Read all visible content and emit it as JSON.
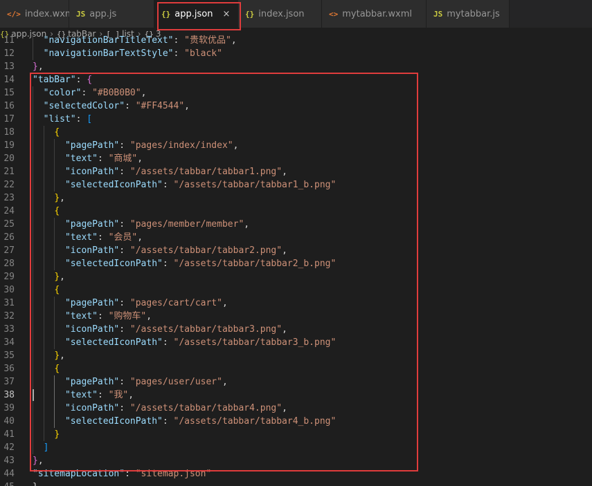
{
  "tabs": [
    {
      "label": "index.wxml",
      "icon": "code-file-icon",
      "kind": "wxml",
      "glyph": "</>"
    },
    {
      "label": "app.js",
      "icon": "js-file-icon",
      "kind": "js",
      "glyph": "JS"
    },
    {
      "label": "app.json",
      "icon": "json-file-icon",
      "kind": "json",
      "glyph": "{}",
      "active": true
    },
    {
      "label": "index.json",
      "icon": "json-file-icon",
      "kind": "json",
      "glyph": "{}"
    },
    {
      "label": "mytabbar.wxml",
      "icon": "code-file-icon",
      "kind": "wxml",
      "glyph": "<>"
    },
    {
      "label": "mytabbar.js",
      "icon": "js-file-icon",
      "kind": "js",
      "glyph": "JS"
    }
  ],
  "close_glyph": "×",
  "breadcrumb": [
    {
      "label": "app.json",
      "glyph": "{}"
    },
    {
      "label": "tabBar",
      "glyph": "{}"
    },
    {
      "label": "list",
      "glyph": "[ ]"
    },
    {
      "label": "3",
      "glyph": "{}"
    }
  ],
  "breadcrumb_sep": "›",
  "editor": {
    "current_line": 38,
    "lines": [
      {
        "n": 11,
        "text": "  \"navigationBarTitleText\": \"贵软优品\","
      },
      {
        "n": 12,
        "text": "  \"navigationBarTextStyle\": \"black\""
      },
      {
        "n": 13,
        "text": "},"
      },
      {
        "n": 14,
        "text": "\"tabBar\": {"
      },
      {
        "n": 15,
        "text": "  \"color\": \"#B0B0B0\","
      },
      {
        "n": 16,
        "text": "  \"selectedColor\": \"#FF4544\","
      },
      {
        "n": 17,
        "text": "  \"list\": ["
      },
      {
        "n": 18,
        "text": "    {"
      },
      {
        "n": 19,
        "text": "      \"pagePath\": \"pages/index/index\","
      },
      {
        "n": 20,
        "text": "      \"text\": \"商城\","
      },
      {
        "n": 21,
        "text": "      \"iconPath\": \"/assets/tabbar/tabbar1.png\","
      },
      {
        "n": 22,
        "text": "      \"selectedIconPath\": \"/assets/tabbar/tabbar1_b.png\""
      },
      {
        "n": 23,
        "text": "    },"
      },
      {
        "n": 24,
        "text": "    {"
      },
      {
        "n": 25,
        "text": "      \"pagePath\": \"pages/member/member\","
      },
      {
        "n": 26,
        "text": "      \"text\": \"会员\","
      },
      {
        "n": 27,
        "text": "      \"iconPath\": \"/assets/tabbar/tabbar2.png\","
      },
      {
        "n": 28,
        "text": "      \"selectedIconPath\": \"/assets/tabbar/tabbar2_b.png\""
      },
      {
        "n": 29,
        "text": "    },"
      },
      {
        "n": 30,
        "text": "    {"
      },
      {
        "n": 31,
        "text": "      \"pagePath\": \"pages/cart/cart\","
      },
      {
        "n": 32,
        "text": "      \"text\": \"购物车\","
      },
      {
        "n": 33,
        "text": "      \"iconPath\": \"/assets/tabbar/tabbar3.png\","
      },
      {
        "n": 34,
        "text": "      \"selectedIconPath\": \"/assets/tabbar/tabbar3_b.png\""
      },
      {
        "n": 35,
        "text": "    },"
      },
      {
        "n": 36,
        "text": "    {"
      },
      {
        "n": 37,
        "text": "      \"pagePath\": \"pages/user/user\","
      },
      {
        "n": 38,
        "text": "      \"text\": \"我\","
      },
      {
        "n": 39,
        "text": "      \"iconPath\": \"/assets/tabbar/tabbar4.png\","
      },
      {
        "n": 40,
        "text": "      \"selectedIconPath\": \"/assets/tabbar/tabbar4_b.png\""
      },
      {
        "n": 41,
        "text": "    }"
      },
      {
        "n": 42,
        "text": "  ]"
      },
      {
        "n": 43,
        "text": "},"
      },
      {
        "n": 44,
        "text": "\"sitemapLocation\": \"sitemap.json\""
      },
      {
        "n": 45,
        "text": "}"
      }
    ]
  },
  "colors": {
    "highlight_box": "#e03c3c",
    "key": "#9cdcfe",
    "string": "#ce9178",
    "bracket_level1": "#da70d6",
    "bracket_level2": "#179fff",
    "bracket_level3": "#ffd700"
  }
}
